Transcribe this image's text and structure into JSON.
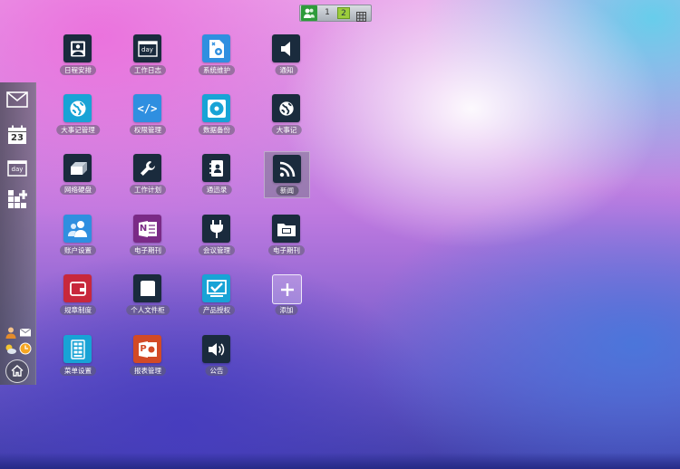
{
  "pager": {
    "pages": [
      "1",
      "2"
    ],
    "active_page": "2"
  },
  "sidebar": {
    "items": [
      {
        "name": "mail",
        "icon": "mail-icon"
      },
      {
        "name": "calendar",
        "icon": "calendar-icon",
        "text": "23"
      },
      {
        "name": "day-log",
        "icon": "day-icon",
        "text": "day"
      },
      {
        "name": "apps",
        "icon": "apps-grid-icon"
      }
    ]
  },
  "apps": [
    {
      "label": "日程安排",
      "color": "#1a2b3d",
      "icon": "schedule-icon"
    },
    {
      "label": "工作日志",
      "color": "#1a2b3d",
      "icon": "day-icon",
      "text": "day"
    },
    {
      "label": "系统维护",
      "color": "#2f8fe0",
      "icon": "system-maintenance-icon"
    },
    {
      "label": "通知",
      "color": "#1a2b3d",
      "icon": "speaker-icon"
    },
    {
      "label": "大事记管理",
      "color": "#18a3d6",
      "icon": "globe-icon"
    },
    {
      "label": "权限管理",
      "color": "#2f8fe0",
      "icon": "code-icon",
      "text": "</>"
    },
    {
      "label": "数据备份",
      "color": "#18a3d6",
      "icon": "disc-icon"
    },
    {
      "label": "大事记",
      "color": "#1a2b3d",
      "icon": "globe-icon"
    },
    {
      "label": "网络硬盘",
      "color": "#1a2b3d",
      "icon": "hard-drive-icon"
    },
    {
      "label": "工作计划",
      "color": "#1a2b3d",
      "icon": "wrench-icon"
    },
    {
      "label": "通迅录",
      "color": "#1a2b3d",
      "icon": "address-book-icon"
    },
    {
      "label": "新闻",
      "color": "#1a2b3d",
      "icon": "rss-icon"
    },
    {
      "label": "账户设置",
      "color": "#2f8fe0",
      "icon": "users-icon"
    },
    {
      "label": "电子期刊",
      "color": "#7a2a86",
      "icon": "onenote-icon",
      "text": "N"
    },
    {
      "label": "会议管理",
      "color": "#1a2b3d",
      "icon": "plug-icon"
    },
    {
      "label": "电子期刊",
      "color": "#1a2b3d",
      "icon": "folder-icon"
    },
    {
      "label": "规章制度",
      "color": "#c8283c",
      "icon": "wallet-icon"
    },
    {
      "label": "个人文件柜",
      "color": "#1a2b3d",
      "icon": "file-cabinet-icon"
    },
    {
      "label": "产品授权",
      "color": "#18a3d6",
      "icon": "monitor-check-icon"
    },
    {
      "label": "添加",
      "color": "#ffffff",
      "icon": "plus-icon"
    },
    {
      "label": "菜单设置",
      "color": "#18a3d6",
      "icon": "menu-grid-icon"
    },
    {
      "label": "报表管理",
      "color": "#d24a26",
      "icon": "powerpoint-icon",
      "text": "P"
    },
    {
      "label": "公告",
      "color": "#1a2b3d",
      "icon": "volume-icon"
    }
  ]
}
